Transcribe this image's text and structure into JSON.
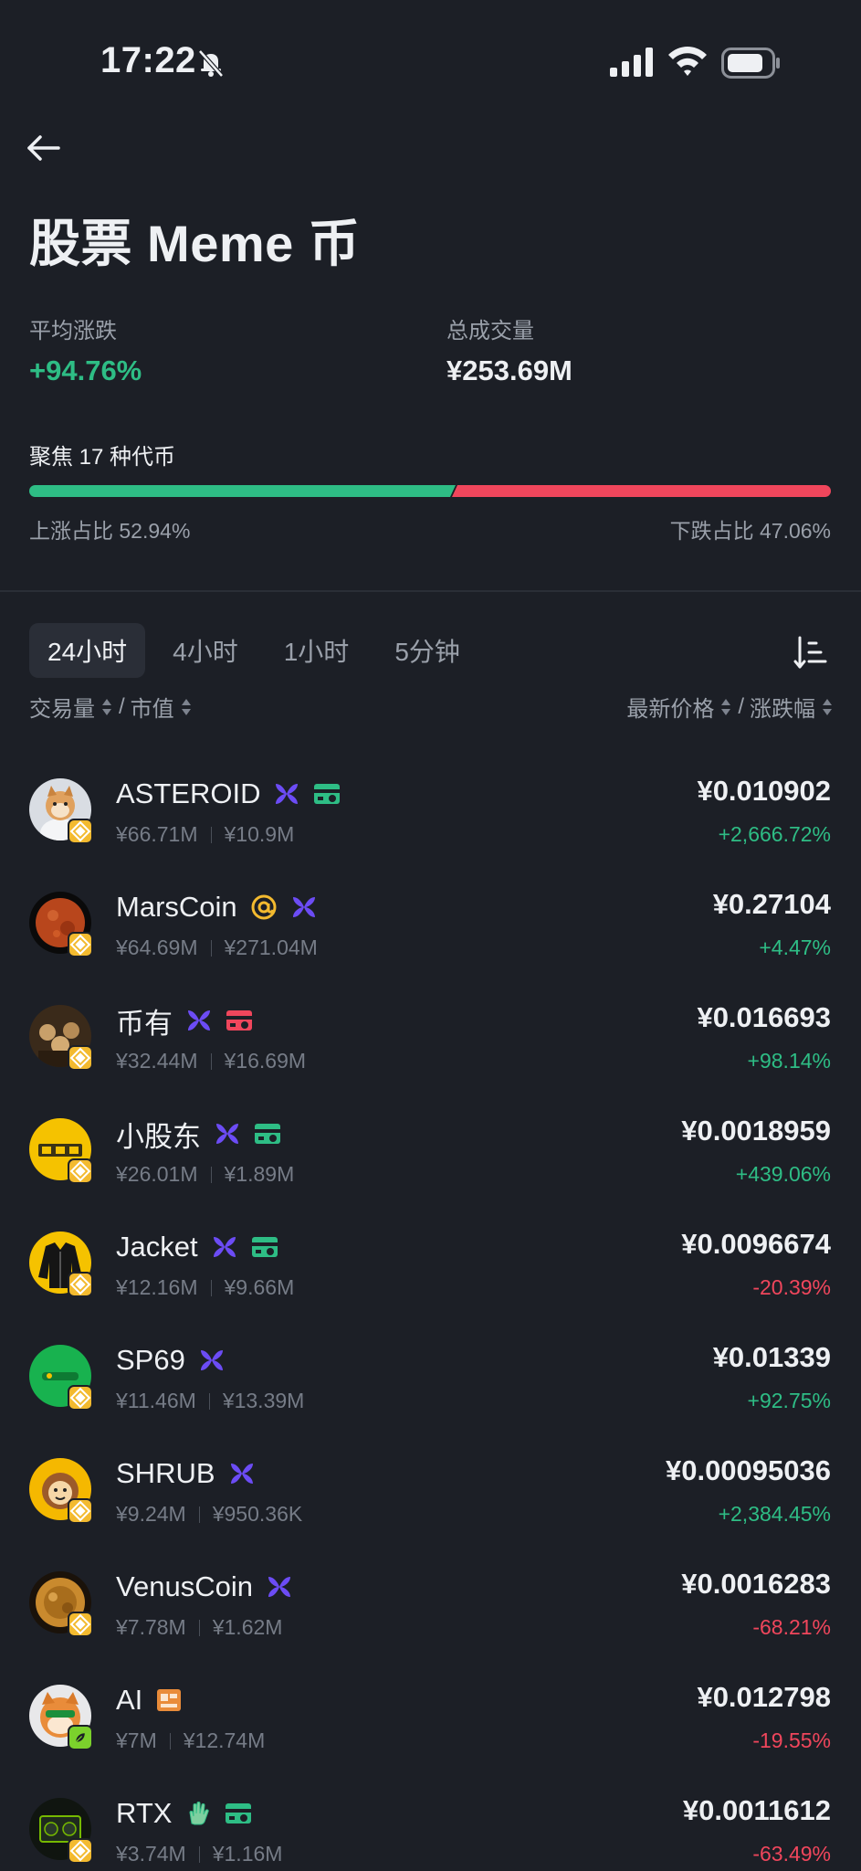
{
  "status_bar": {
    "time": "17:22"
  },
  "header": {
    "title": "股票 Meme 币"
  },
  "stats": {
    "avg_change_label": "平均涨跌",
    "avg_change_value": "+94.76%",
    "volume_label": "总成交量",
    "volume_value": "¥253.69M"
  },
  "focus": {
    "label": "聚焦 17 种代币",
    "up_ratio_label": "上涨占比 52.94%",
    "down_ratio_label": "下跌占比 47.06%",
    "up_fraction": 0.5294,
    "down_fraction": 0.4706
  },
  "tabs": [
    {
      "label": "24小时",
      "active": true
    },
    {
      "label": "4小时",
      "active": false
    },
    {
      "label": "1小时",
      "active": false
    },
    {
      "label": "5分钟",
      "active": false
    }
  ],
  "columns": {
    "volume": "交易量",
    "slash": "/",
    "market_cap": "市值",
    "price": "最新价格",
    "change": "涨跌幅"
  },
  "colors": {
    "up": "#2ebd85",
    "down": "#f0465c",
    "bnb": "#f3ba2f",
    "purple_tag": "#6c4cf5"
  },
  "coins": [
    {
      "name": "ASTEROID",
      "volume": "¥66.71M",
      "mcap": "¥10.9M",
      "price": "¥0.010902",
      "change": "+2,666.72%",
      "dir": "up",
      "tags": [
        "butterfly-icon",
        "green-card-icon"
      ]
    },
    {
      "name": "MarsCoin",
      "volume": "¥64.69M",
      "mcap": "¥271.04M",
      "price": "¥0.27104",
      "change": "+4.47%",
      "dir": "up",
      "tags": [
        "at-sign-icon",
        "butterfly-icon"
      ]
    },
    {
      "name": "币有",
      "volume": "¥32.44M",
      "mcap": "¥16.69M",
      "price": "¥0.016693",
      "change": "+98.14%",
      "dir": "up",
      "tags": [
        "butterfly-icon",
        "red-card-icon"
      ]
    },
    {
      "name": "小股东",
      "volume": "¥26.01M",
      "mcap": "¥1.89M",
      "price": "¥0.0018959",
      "change": "+439.06%",
      "dir": "up",
      "tags": [
        "butterfly-icon",
        "green-card-icon"
      ]
    },
    {
      "name": "Jacket",
      "volume": "¥12.16M",
      "mcap": "¥9.66M",
      "price": "¥0.0096674",
      "change": "-20.39%",
      "dir": "down",
      "tags": [
        "butterfly-icon",
        "green-card-icon"
      ]
    },
    {
      "name": "SP69",
      "volume": "¥11.46M",
      "mcap": "¥13.39M",
      "price": "¥0.01339",
      "change": "+92.75%",
      "dir": "up",
      "tags": [
        "butterfly-icon"
      ]
    },
    {
      "name": "SHRUB",
      "volume": "¥9.24M",
      "mcap": "¥950.36K",
      "price": "¥0.00095036",
      "change": "+2,384.45%",
      "dir": "up",
      "tags": [
        "butterfly-icon"
      ]
    },
    {
      "name": "VenusCoin",
      "volume": "¥7.78M",
      "mcap": "¥1.62M",
      "price": "¥0.0016283",
      "change": "-68.21%",
      "dir": "down",
      "tags": [
        "butterfly-icon"
      ]
    },
    {
      "name": "AI",
      "volume": "¥7M",
      "mcap": "¥12.74M",
      "price": "¥0.012798",
      "change": "-19.55%",
      "dir": "down",
      "tags": [
        "orange-face-icon"
      ]
    },
    {
      "name": "RTX",
      "volume": "¥3.74M",
      "mcap": "¥1.16M",
      "price": "¥0.0011612",
      "change": "-63.49%",
      "dir": "down",
      "tags": [
        "green-hand-icon",
        "green-card-icon"
      ]
    }
  ]
}
